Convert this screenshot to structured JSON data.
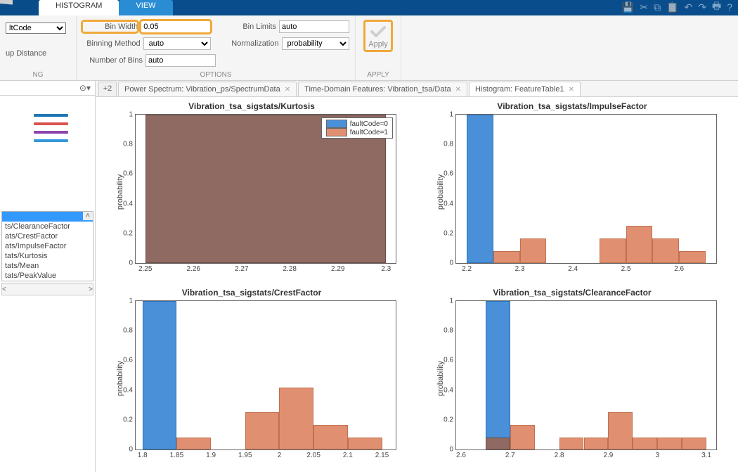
{
  "tabs": {
    "histogram": "HISTOGRAM",
    "view": "VIEW"
  },
  "leftCol": {
    "selValue": "ltCode",
    "distance": "up Distance",
    "footer": "NG"
  },
  "options": {
    "binWidthLabel": "Bin Width",
    "binWidthValue": "0.05",
    "binLimitsLabel": "Bin Limits",
    "binLimitsValue": "auto",
    "binMethodLabel": "Binning Method",
    "binMethodValue": "auto",
    "normLabel": "Normalization",
    "normValue": "probability",
    "numBinsLabel": "Number of Bins",
    "numBinsValue": "auto",
    "footer": "OPTIONS"
  },
  "apply": {
    "label": "Apply",
    "footer": "APPLY"
  },
  "legendColors": [
    "#1f77b4",
    "#d9534f",
    "#8e44ad",
    "#3498db"
  ],
  "list": {
    "items": [
      "ts/ClearanceFactor",
      "ats/CrestFactor",
      "ats/ImpulseFactor",
      "tats/Kurtosis",
      "tats/Mean",
      "tats/PeakValue"
    ]
  },
  "plusTab": "+2",
  "docTabs": [
    {
      "label": "Power Spectrum: Vibration_ps/SpectrumData",
      "active": false
    },
    {
      "label": "Time-Domain Features: Vibration_tsa/Data",
      "active": false
    },
    {
      "label": "Histogram: FeatureTable1",
      "active": true
    }
  ],
  "legendPlot": {
    "a": "faultCode=0",
    "b": "faultCode=1"
  },
  "ylabel": "probability",
  "yticks": [
    0,
    0.2,
    0.4,
    0.6,
    0.8,
    1
  ],
  "charts": [
    {
      "title": "Vibration_tsa_sigstats/Kurtosis",
      "xticks": [
        2.25,
        2.26,
        2.27,
        2.28,
        2.29,
        2.3
      ]
    },
    {
      "title": "Vibration_tsa_sigstats/ImpulseFactor",
      "xticks": [
        2.2,
        2.3,
        2.4,
        2.5,
        2.6
      ]
    },
    {
      "title": "Vibration_tsa_sigstats/CrestFactor",
      "xticks": [
        1.8,
        1.85,
        1.9,
        1.95,
        2,
        2.05,
        2.1,
        2.15
      ]
    },
    {
      "title": "Vibration_tsa_sigstats/ClearanceFactor",
      "xticks": [
        2.6,
        2.7,
        2.8,
        2.9,
        3,
        3.1
      ]
    }
  ],
  "chart_data": [
    {
      "type": "bar",
      "title": "Vibration_tsa_sigstats/Kurtosis",
      "ylabel": "probability",
      "ylim": [
        0,
        1
      ],
      "xlim": [
        2.248,
        2.302
      ],
      "series": [
        {
          "name": "faultCode=0",
          "bins": [
            {
              "x0": 2.25,
              "x1": 2.3,
              "y": 1.0
            }
          ]
        },
        {
          "name": "faultCode=1",
          "bins": [
            {
              "x0": 2.25,
              "x1": 2.3,
              "y": 1.0
            }
          ]
        }
      ]
    },
    {
      "type": "bar",
      "title": "Vibration_tsa_sigstats/ImpulseFactor",
      "ylabel": "probability",
      "ylim": [
        0,
        1
      ],
      "xlim": [
        2.18,
        2.67
      ],
      "series": [
        {
          "name": "faultCode=0",
          "bins": [
            {
              "x0": 2.2,
              "x1": 2.25,
              "y": 1.0
            }
          ]
        },
        {
          "name": "faultCode=1",
          "bins": [
            {
              "x0": 2.25,
              "x1": 2.3,
              "y": 0.083
            },
            {
              "x0": 2.3,
              "x1": 2.35,
              "y": 0.167
            },
            {
              "x0": 2.45,
              "x1": 2.5,
              "y": 0.167
            },
            {
              "x0": 2.5,
              "x1": 2.55,
              "y": 0.25
            },
            {
              "x0": 2.55,
              "x1": 2.6,
              "y": 0.167
            },
            {
              "x0": 2.6,
              "x1": 2.65,
              "y": 0.083
            }
          ]
        }
      ]
    },
    {
      "type": "bar",
      "title": "Vibration_tsa_sigstats/CrestFactor",
      "ylabel": "probability",
      "ylim": [
        0,
        1
      ],
      "xlim": [
        1.79,
        2.17
      ],
      "series": [
        {
          "name": "faultCode=0",
          "bins": [
            {
              "x0": 1.8,
              "x1": 1.85,
              "y": 1.0
            }
          ]
        },
        {
          "name": "faultCode=1",
          "bins": [
            {
              "x0": 1.85,
              "x1": 1.9,
              "y": 0.083
            },
            {
              "x0": 1.95,
              "x1": 2.0,
              "y": 0.25
            },
            {
              "x0": 2.0,
              "x1": 2.05,
              "y": 0.417
            },
            {
              "x0": 2.05,
              "x1": 2.1,
              "y": 0.167
            },
            {
              "x0": 2.1,
              "x1": 2.15,
              "y": 0.083
            }
          ]
        }
      ]
    },
    {
      "type": "bar",
      "title": "Vibration_tsa_sigstats/ClearanceFactor",
      "ylabel": "probability",
      "ylim": [
        0,
        1
      ],
      "xlim": [
        2.59,
        3.12
      ],
      "series": [
        {
          "name": "faultCode=0",
          "bins": [
            {
              "x0": 2.65,
              "x1": 2.7,
              "y": 1.0
            }
          ]
        },
        {
          "name": "faultCode=1",
          "bins": [
            {
              "x0": 2.65,
              "x1": 2.7,
              "y": 0.083
            },
            {
              "x0": 2.7,
              "x1": 2.75,
              "y": 0.167
            },
            {
              "x0": 2.8,
              "x1": 2.85,
              "y": 0.083
            },
            {
              "x0": 2.85,
              "x1": 2.9,
              "y": 0.083
            },
            {
              "x0": 2.9,
              "x1": 2.95,
              "y": 0.25
            },
            {
              "x0": 2.95,
              "x1": 3.0,
              "y": 0.083
            },
            {
              "x0": 3.0,
              "x1": 3.05,
              "y": 0.083
            },
            {
              "x0": 3.05,
              "x1": 3.1,
              "y": 0.083
            }
          ]
        }
      ]
    }
  ]
}
